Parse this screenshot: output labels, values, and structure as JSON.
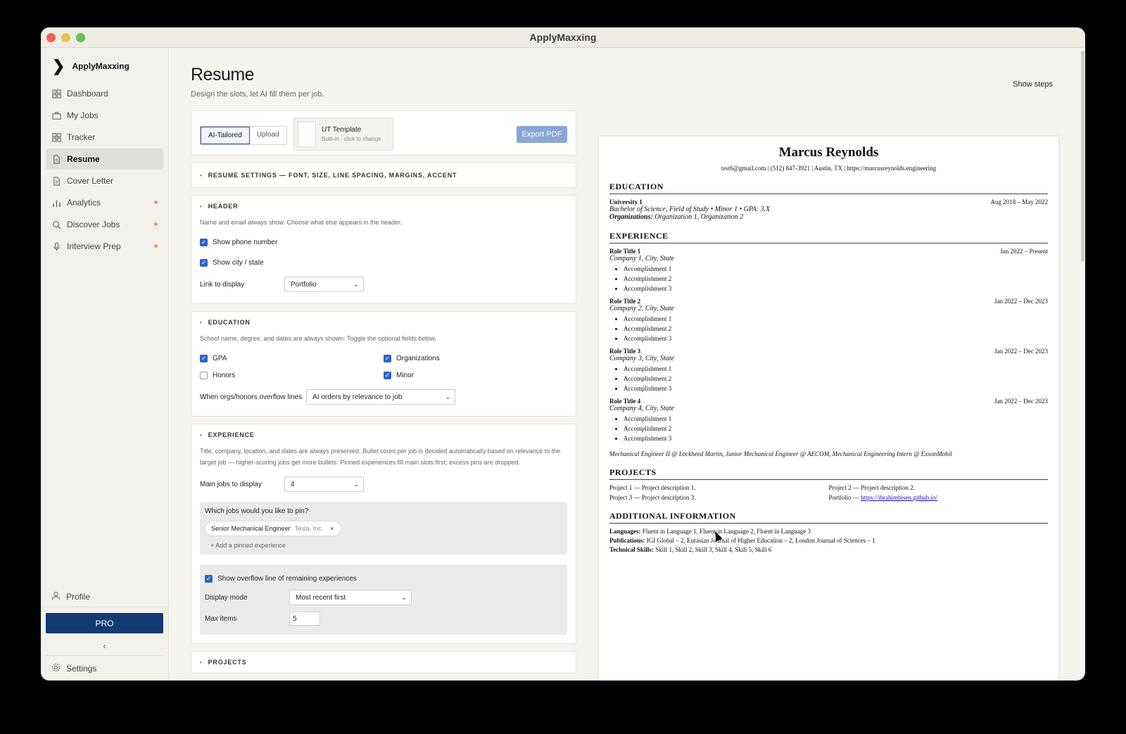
{
  "window": {
    "title": "ApplyMaxxing"
  },
  "sidebar": {
    "brand": "ApplyMaxxing",
    "items": [
      {
        "label": "Dashboard",
        "icon": "grid-icon",
        "active": false,
        "dot": false
      },
      {
        "label": "My Jobs",
        "icon": "briefcase-icon",
        "active": false,
        "dot": false
      },
      {
        "label": "Tracker",
        "icon": "grid-icon",
        "active": false,
        "dot": false
      },
      {
        "label": "Resume",
        "icon": "document-icon",
        "active": true,
        "dot": false
      },
      {
        "label": "Cover Letter",
        "icon": "document-icon",
        "active": false,
        "dot": false
      },
      {
        "label": "Analytics",
        "icon": "bar-chart-icon",
        "active": false,
        "dot": true
      },
      {
        "label": "Discover Jobs",
        "icon": "search-icon",
        "active": false,
        "dot": true
      },
      {
        "label": "Interview Prep",
        "icon": "microphone-icon",
        "active": false,
        "dot": true
      }
    ],
    "profile": "Profile",
    "pro": "PRO",
    "collapse": "‹",
    "settings": "Settings"
  },
  "page": {
    "title": "Resume",
    "subtitle": "Design the slots, let AI fill them per job.",
    "show_steps": "Show steps"
  },
  "toolbar": {
    "ai_tailored": "AI-Tailored",
    "upload": "Upload",
    "template_name": "UT Template",
    "template_sub": "Built-in · click to change",
    "export": "Export PDF"
  },
  "settings_section": {
    "title": "RESUME SETTINGS — FONT, SIZE, LINE SPACING, MARGINS, ACCENT"
  },
  "header_section": {
    "title": "HEADER",
    "help": "Name and email always show. Choose what else appears in the header.",
    "show_phone": "Show phone number",
    "show_city": "Show city / state",
    "link_label": "Link to display",
    "link_value": "Portfolio"
  },
  "education_section": {
    "title": "EDUCATION",
    "help": "School name, degree, and dates are always shown. Toggle the optional fields below.",
    "gpa": "GPA",
    "organizations": "Organizations",
    "honors": "Honors",
    "minor": "Minor",
    "overflow_label": "When orgs/honors overflow lines",
    "overflow_value": "AI orders by relevance to job"
  },
  "experience_section": {
    "title": "EXPERIENCE",
    "help": "Title, company, location, and dates are always preserved. Bullet count per job is decided automatically based on relevance to the target job — higher-scoring jobs get more bullets. Pinned experiences fill main slots first; excess pins are dropped.",
    "main_jobs_label": "Main jobs to display",
    "main_jobs_value": "4",
    "pin_question": "Which jobs would you like to pin?",
    "pin_title": "Senior Mechanical Engineer",
    "pin_company": "Tesla, Inc.",
    "pin_remove": "×",
    "add_pin": "+ Add a pinned experience",
    "overflow_toggle": "Show overflow line of remaining experiences",
    "display_mode_label": "Display mode",
    "display_mode_value": "Most recent first",
    "max_items_label": "Max items",
    "max_items_value": "5"
  },
  "projects_section": {
    "title": "PROJECTS"
  },
  "resume": {
    "name": "Marcus Reynolds",
    "contact": "test6@gmail.com | (512) 847-3921 | Austin, TX | https://marcusreynolds.engineering",
    "education_heading": "EDUCATION",
    "school": "University 1",
    "school_dates": "Aug 2018 – May 2022",
    "degree": "Bachelor of Science, Field of Study • Minor 1 • GPA: 3.X",
    "orgs_label": "Organizations:",
    "orgs": "Organization 1, Organization 2",
    "experience_heading": "EXPERIENCE",
    "jobs": [
      {
        "title": "Role Title 1",
        "dates": "Jan 2022 – Present",
        "company": "Company 1, City, State",
        "bullets": [
          "Accomplishment 1",
          "Accomplishment 2",
          "Accomplishment 3"
        ]
      },
      {
        "title": "Role Title 2",
        "dates": "Jan 2022 – Dec 2023",
        "company": "Company 2, City, State",
        "bullets": [
          "Accomplishment 1",
          "Accomplishment 2",
          "Accomplishment 3"
        ]
      },
      {
        "title": "Role Title 3",
        "dates": "Jan 2022 – Dec 2023",
        "company": "Company 3, City, State",
        "bullets": [
          "Accomplishment 1",
          "Accomplishment 2",
          "Accomplishment 3"
        ]
      },
      {
        "title": "Role Title 4",
        "dates": "Jan 2022 – Dec 2023",
        "company": "Company 4, City, State",
        "bullets": [
          "Accomplishment 1",
          "Accomplishment 2",
          "Accomplishment 3"
        ]
      }
    ],
    "overflow_line": "Mechanical Engineer II @ Lockheed Martin, Junior Mechanical Engineer @ AECOM, Mechanical Engineering Intern @ ExxonMobil",
    "projects_heading": "PROJECTS",
    "project1": "Project 1 — Project description 1.",
    "project2": "Project 2 — Project description 2.",
    "project3": "Project 3 — Project description 3.",
    "portfolio_label": "Portfolio — ",
    "portfolio_link": "https://ibrahimbisen.github.io/",
    "additional_heading": "ADDITIONAL INFORMATION",
    "languages_label": "Languages:",
    "languages": "Fluent in Language 1, Fluent in Language 2, Fluent in Language 3",
    "publications_label": "Publications:",
    "publications": "IGI Global – 2, Eurasian Journal of Higher Education – 2, London Journal of Sciences – 1",
    "skills_label": "Technical Skills:",
    "skills": "Skill 1, Skill 2, Skill 3, Skill 4, Skill 5, Skill 6"
  }
}
